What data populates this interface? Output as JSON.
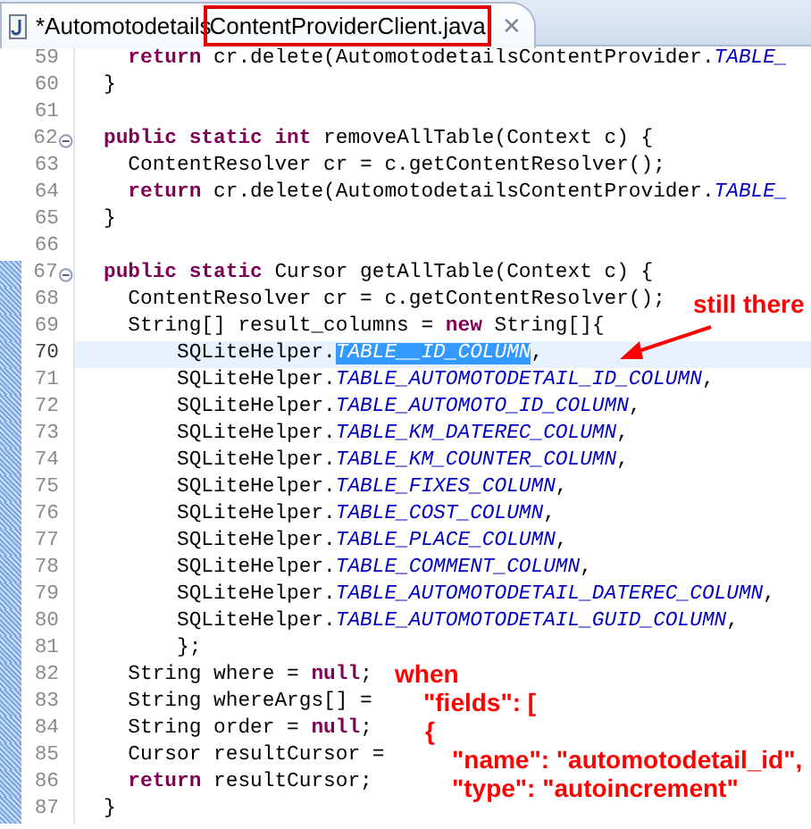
{
  "tab": {
    "title_prefix": "*Automotodetails",
    "title_marked": "ContentProviderClient.java",
    "close": "✕"
  },
  "editor": {
    "lines": [
      {
        "number": "59",
        "tokens": [
          {
            "kind": "keyword",
            "text": "  return"
          },
          {
            "kind": "plain",
            "text": " cr.delete(AutomotodetailsContentProvider."
          },
          {
            "kind": "field",
            "text": "TABLE_"
          }
        ]
      },
      {
        "number": "60",
        "tokens": [
          {
            "kind": "plain",
            "text": "}"
          }
        ]
      },
      {
        "number": "61"
      },
      {
        "number": "62",
        "collapsed": false,
        "tokens": [
          {
            "kind": "keyword",
            "text": "public static int"
          },
          {
            "kind": "plain",
            "text": " removeAllTable(Context c) {"
          }
        ]
      },
      {
        "number": "63",
        "tokens": [
          {
            "kind": "plain",
            "text": "  ContentResolver cr = c.getContentResolver();"
          }
        ]
      },
      {
        "number": "64",
        "tokens": [
          {
            "kind": "keyword",
            "text": "  return"
          },
          {
            "kind": "plain",
            "text": " cr.delete(AutomotodetailsContentProvider."
          },
          {
            "kind": "field",
            "text": "TABLE_"
          }
        ]
      },
      {
        "number": "65",
        "tokens": [
          {
            "kind": "plain",
            "text": "}"
          }
        ]
      },
      {
        "number": "66"
      },
      {
        "number": "67",
        "collapsed": false,
        "changed": true,
        "tokens": [
          {
            "kind": "keyword",
            "text": "public static"
          },
          {
            "kind": "plain",
            "text": " Cursor getAllTable(Context c) {"
          }
        ]
      },
      {
        "number": "68",
        "changed": true,
        "tokens": [
          {
            "kind": "plain",
            "text": "  ContentResolver cr = c.getContentResolver();"
          }
        ]
      },
      {
        "number": "69",
        "changed": true,
        "tokens": [
          {
            "kind": "plain",
            "text": "  String[] result_columns = "
          },
          {
            "kind": "keyword",
            "text": "new"
          },
          {
            "kind": "plain",
            "text": " String[]{"
          }
        ]
      },
      {
        "number": "70",
        "changed": true,
        "current": true,
        "tokens": [
          {
            "kind": "plain",
            "text": "      SQLiteHelper."
          },
          {
            "kind": "selected",
            "text": "TABLE__ID_COLUMN"
          },
          {
            "kind": "plain",
            "text": ","
          }
        ]
      },
      {
        "number": "71",
        "changed": true,
        "tokens": [
          {
            "kind": "plain",
            "text": "      SQLiteHelper."
          },
          {
            "kind": "field",
            "text": "TABLE_AUTOMOTODETAIL_ID_COLUMN"
          },
          {
            "kind": "plain",
            "text": ","
          }
        ]
      },
      {
        "number": "72",
        "changed": true,
        "tokens": [
          {
            "kind": "plain",
            "text": "      SQLiteHelper."
          },
          {
            "kind": "field",
            "text": "TABLE_AUTOMOTO_ID_COLUMN"
          },
          {
            "kind": "plain",
            "text": ","
          }
        ]
      },
      {
        "number": "73",
        "changed": true,
        "tokens": [
          {
            "kind": "plain",
            "text": "      SQLiteHelper."
          },
          {
            "kind": "field",
            "text": "TABLE_KM_DATEREC_COLUMN"
          },
          {
            "kind": "plain",
            "text": ","
          }
        ]
      },
      {
        "number": "74",
        "changed": true,
        "tokens": [
          {
            "kind": "plain",
            "text": "      SQLiteHelper."
          },
          {
            "kind": "field",
            "text": "TABLE_KM_COUNTER_COLUMN"
          },
          {
            "kind": "plain",
            "text": ","
          }
        ]
      },
      {
        "number": "75",
        "changed": true,
        "tokens": [
          {
            "kind": "plain",
            "text": "      SQLiteHelper."
          },
          {
            "kind": "field",
            "text": "TABLE_FIXES_COLUMN"
          },
          {
            "kind": "plain",
            "text": ","
          }
        ]
      },
      {
        "number": "76",
        "changed": true,
        "tokens": [
          {
            "kind": "plain",
            "text": "      SQLiteHelper."
          },
          {
            "kind": "field",
            "text": "TABLE_COST_COLUMN"
          },
          {
            "kind": "plain",
            "text": ","
          }
        ]
      },
      {
        "number": "77",
        "changed": true,
        "tokens": [
          {
            "kind": "plain",
            "text": "      SQLiteHelper."
          },
          {
            "kind": "field",
            "text": "TABLE_PLACE_COLUMN"
          },
          {
            "kind": "plain",
            "text": ","
          }
        ]
      },
      {
        "number": "78",
        "changed": true,
        "tokens": [
          {
            "kind": "plain",
            "text": "      SQLiteHelper."
          },
          {
            "kind": "field",
            "text": "TABLE_COMMENT_COLUMN"
          },
          {
            "kind": "plain",
            "text": ","
          }
        ]
      },
      {
        "number": "79",
        "changed": true,
        "tokens": [
          {
            "kind": "plain",
            "text": "      SQLiteHelper."
          },
          {
            "kind": "field",
            "text": "TABLE_AUTOMOTODETAIL_DATEREC_COLUMN"
          },
          {
            "kind": "plain",
            "text": ","
          }
        ]
      },
      {
        "number": "80",
        "changed": true,
        "tokens": [
          {
            "kind": "plain",
            "text": "      SQLiteHelper."
          },
          {
            "kind": "field",
            "text": "TABLE_AUTOMOTODETAIL_GUID_COLUMN"
          },
          {
            "kind": "plain",
            "text": ","
          }
        ]
      },
      {
        "number": "81",
        "changed": true,
        "tokens": [
          {
            "kind": "plain",
            "text": "      };"
          }
        ]
      },
      {
        "number": "82",
        "changed": true,
        "tokens": [
          {
            "kind": "plain",
            "text": "  String where = "
          },
          {
            "kind": "keyword",
            "text": "null"
          },
          {
            "kind": "plain",
            "text": ";"
          }
        ]
      },
      {
        "number": "83",
        "changed": true,
        "tokens": [
          {
            "kind": "plain",
            "text": "  String whereArgs[] ="
          }
        ]
      },
      {
        "number": "84",
        "changed": true,
        "tokens": [
          {
            "kind": "plain",
            "text": "  String order = "
          },
          {
            "kind": "keyword",
            "text": "null"
          },
          {
            "kind": "plain",
            "text": ";"
          }
        ]
      },
      {
        "number": "85",
        "changed": true,
        "tokens": [
          {
            "kind": "plain",
            "text": "  Cursor resultCursor ="
          }
        ]
      },
      {
        "number": "86",
        "changed": true,
        "tokens": [
          {
            "kind": "keyword",
            "text": "  return"
          },
          {
            "kind": "plain",
            "text": " resultCursor;"
          }
        ]
      },
      {
        "number": "87",
        "changed": true,
        "tokens": [
          {
            "kind": "plain",
            "text": "}"
          }
        ]
      }
    ]
  },
  "annotations": {
    "callout": "still there",
    "note_lines": [
      "when",
      "\"fields\": [",
      "{",
      "\"name\": \"automotodetail_id\",",
      "\"type\": \"autoincrement\""
    ]
  }
}
